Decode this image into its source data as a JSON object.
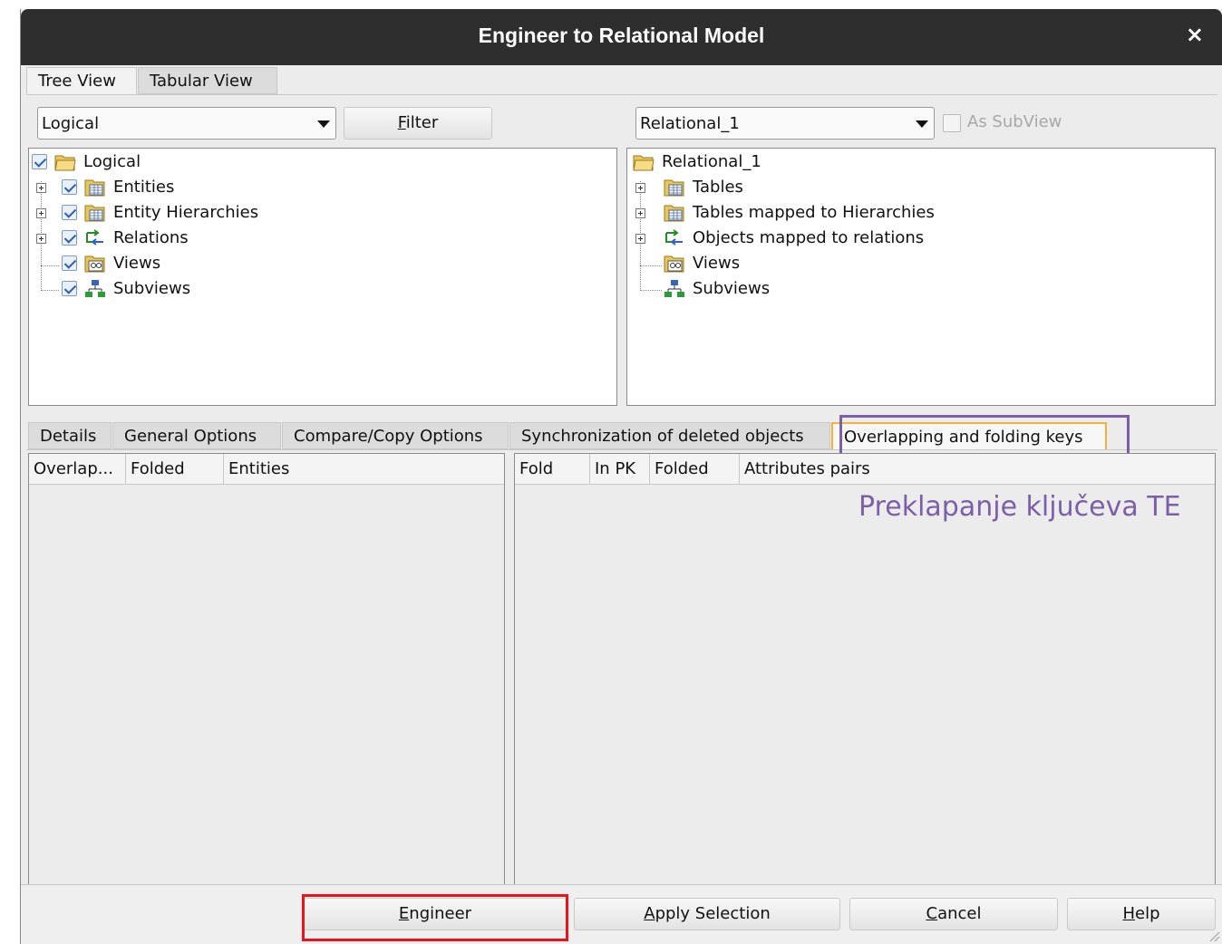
{
  "dialog": {
    "title": "Engineer to Relational Model",
    "close_icon": "×"
  },
  "top_tabs": [
    "Tree View",
    "Tabular View"
  ],
  "left_panel": {
    "combo_value": "Logical",
    "filter_button": {
      "mnemonic": "F",
      "rest": "ilter"
    },
    "tree": [
      {
        "label": "Logical",
        "icon": "folder-open-icon",
        "checked": true
      },
      {
        "label": "Entities",
        "icon": "table-folder-icon",
        "checked": true
      },
      {
        "label": "Entity Hierarchies",
        "icon": "table-folder-icon",
        "checked": true
      },
      {
        "label": "Relations",
        "icon": "relations-icon",
        "checked": true
      },
      {
        "label": "Views",
        "icon": "views-icon",
        "checked": true
      },
      {
        "label": "Subviews",
        "icon": "subviews-icon",
        "checked": true
      }
    ]
  },
  "right_panel": {
    "combo_value": "Relational_1",
    "as_subview_label": "As SubView",
    "tree": [
      {
        "label": "Relational_1",
        "icon": "folder-open-icon"
      },
      {
        "label": "Tables",
        "icon": "table-folder-icon"
      },
      {
        "label": "Tables mapped to Hierarchies",
        "icon": "table-folder-icon"
      },
      {
        "label": "Objects mapped to relations",
        "icon": "relations-icon"
      },
      {
        "label": "Views",
        "icon": "views-icon"
      },
      {
        "label": "Subviews",
        "icon": "subviews-icon"
      }
    ]
  },
  "bottom_tabs": [
    "Details",
    "General Options",
    "Compare/Copy Options",
    "Synchronization of deleted objects",
    "Overlapping and folding keys"
  ],
  "left_grid_headers": [
    "Overlap...",
    "Folded",
    "Entities"
  ],
  "right_grid_headers": [
    "Fold",
    "In PK",
    "Folded",
    "Attributes pairs"
  ],
  "annotation": {
    "text": "Preklapanje ključeva TE",
    "color": "#7b5fa8"
  },
  "footer": {
    "engineer": {
      "mnemonic": "E",
      "rest": "ngineer"
    },
    "apply": {
      "mnemonic": "A",
      "rest": "pply Selection"
    },
    "cancel": {
      "mnemonic": "C",
      "rest": "ancel"
    },
    "help": {
      "mnemonic": "H",
      "rest": "elp"
    }
  },
  "colors": {
    "highlight_red": "#e8141a",
    "highlight_purple": "#7b5fa8",
    "active_tab_border": "#f0b43c"
  }
}
